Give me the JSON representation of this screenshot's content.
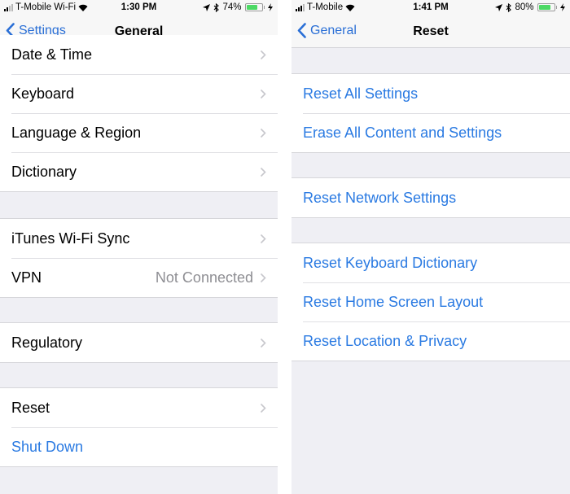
{
  "colors": {
    "accent_blue": "#2a7ae2",
    "background_grouped": "#efeff4",
    "battery_green": "#4cd964"
  },
  "left_screen": {
    "status_bar": {
      "carrier": "T-Mobile Wi-Fi",
      "time": "1:30 PM",
      "battery_percent": "74%",
      "battery_level": 0.74,
      "icons": [
        "signal-icon",
        "wifi-icon",
        "location-icon",
        "bluetooth-icon",
        "battery-icon",
        "charging-icon"
      ]
    },
    "nav": {
      "back_label": "Settings",
      "title": "General"
    },
    "groups": [
      {
        "rows": [
          {
            "label": "Date & Time",
            "chevron": true
          },
          {
            "label": "Keyboard",
            "chevron": true
          },
          {
            "label": "Language & Region",
            "chevron": true
          },
          {
            "label": "Dictionary",
            "chevron": true
          }
        ]
      },
      {
        "rows": [
          {
            "label": "iTunes Wi-Fi Sync",
            "chevron": true
          },
          {
            "label": "VPN",
            "value": "Not Connected",
            "chevron": true
          }
        ]
      },
      {
        "rows": [
          {
            "label": "Regulatory",
            "chevron": true
          }
        ]
      },
      {
        "rows": [
          {
            "label": "Reset",
            "chevron": true
          },
          {
            "label": "Shut Down",
            "chevron": false,
            "style": "blue"
          }
        ]
      }
    ]
  },
  "right_screen": {
    "status_bar": {
      "carrier": "T-Mobile",
      "time": "1:41 PM",
      "battery_percent": "80%",
      "battery_level": 0.8,
      "icons": [
        "signal-icon",
        "wifi-icon",
        "location-icon",
        "bluetooth-icon",
        "battery-icon",
        "charging-icon"
      ]
    },
    "nav": {
      "back_label": "General",
      "title": "Reset"
    },
    "groups": [
      {
        "rows": [
          {
            "label": "Reset All Settings"
          },
          {
            "label": "Erase All Content and Settings"
          }
        ]
      },
      {
        "rows": [
          {
            "label": "Reset Network Settings"
          }
        ]
      },
      {
        "rows": [
          {
            "label": "Reset Keyboard Dictionary"
          },
          {
            "label": "Reset Home Screen Layout"
          },
          {
            "label": "Reset Location & Privacy"
          }
        ]
      }
    ]
  }
}
